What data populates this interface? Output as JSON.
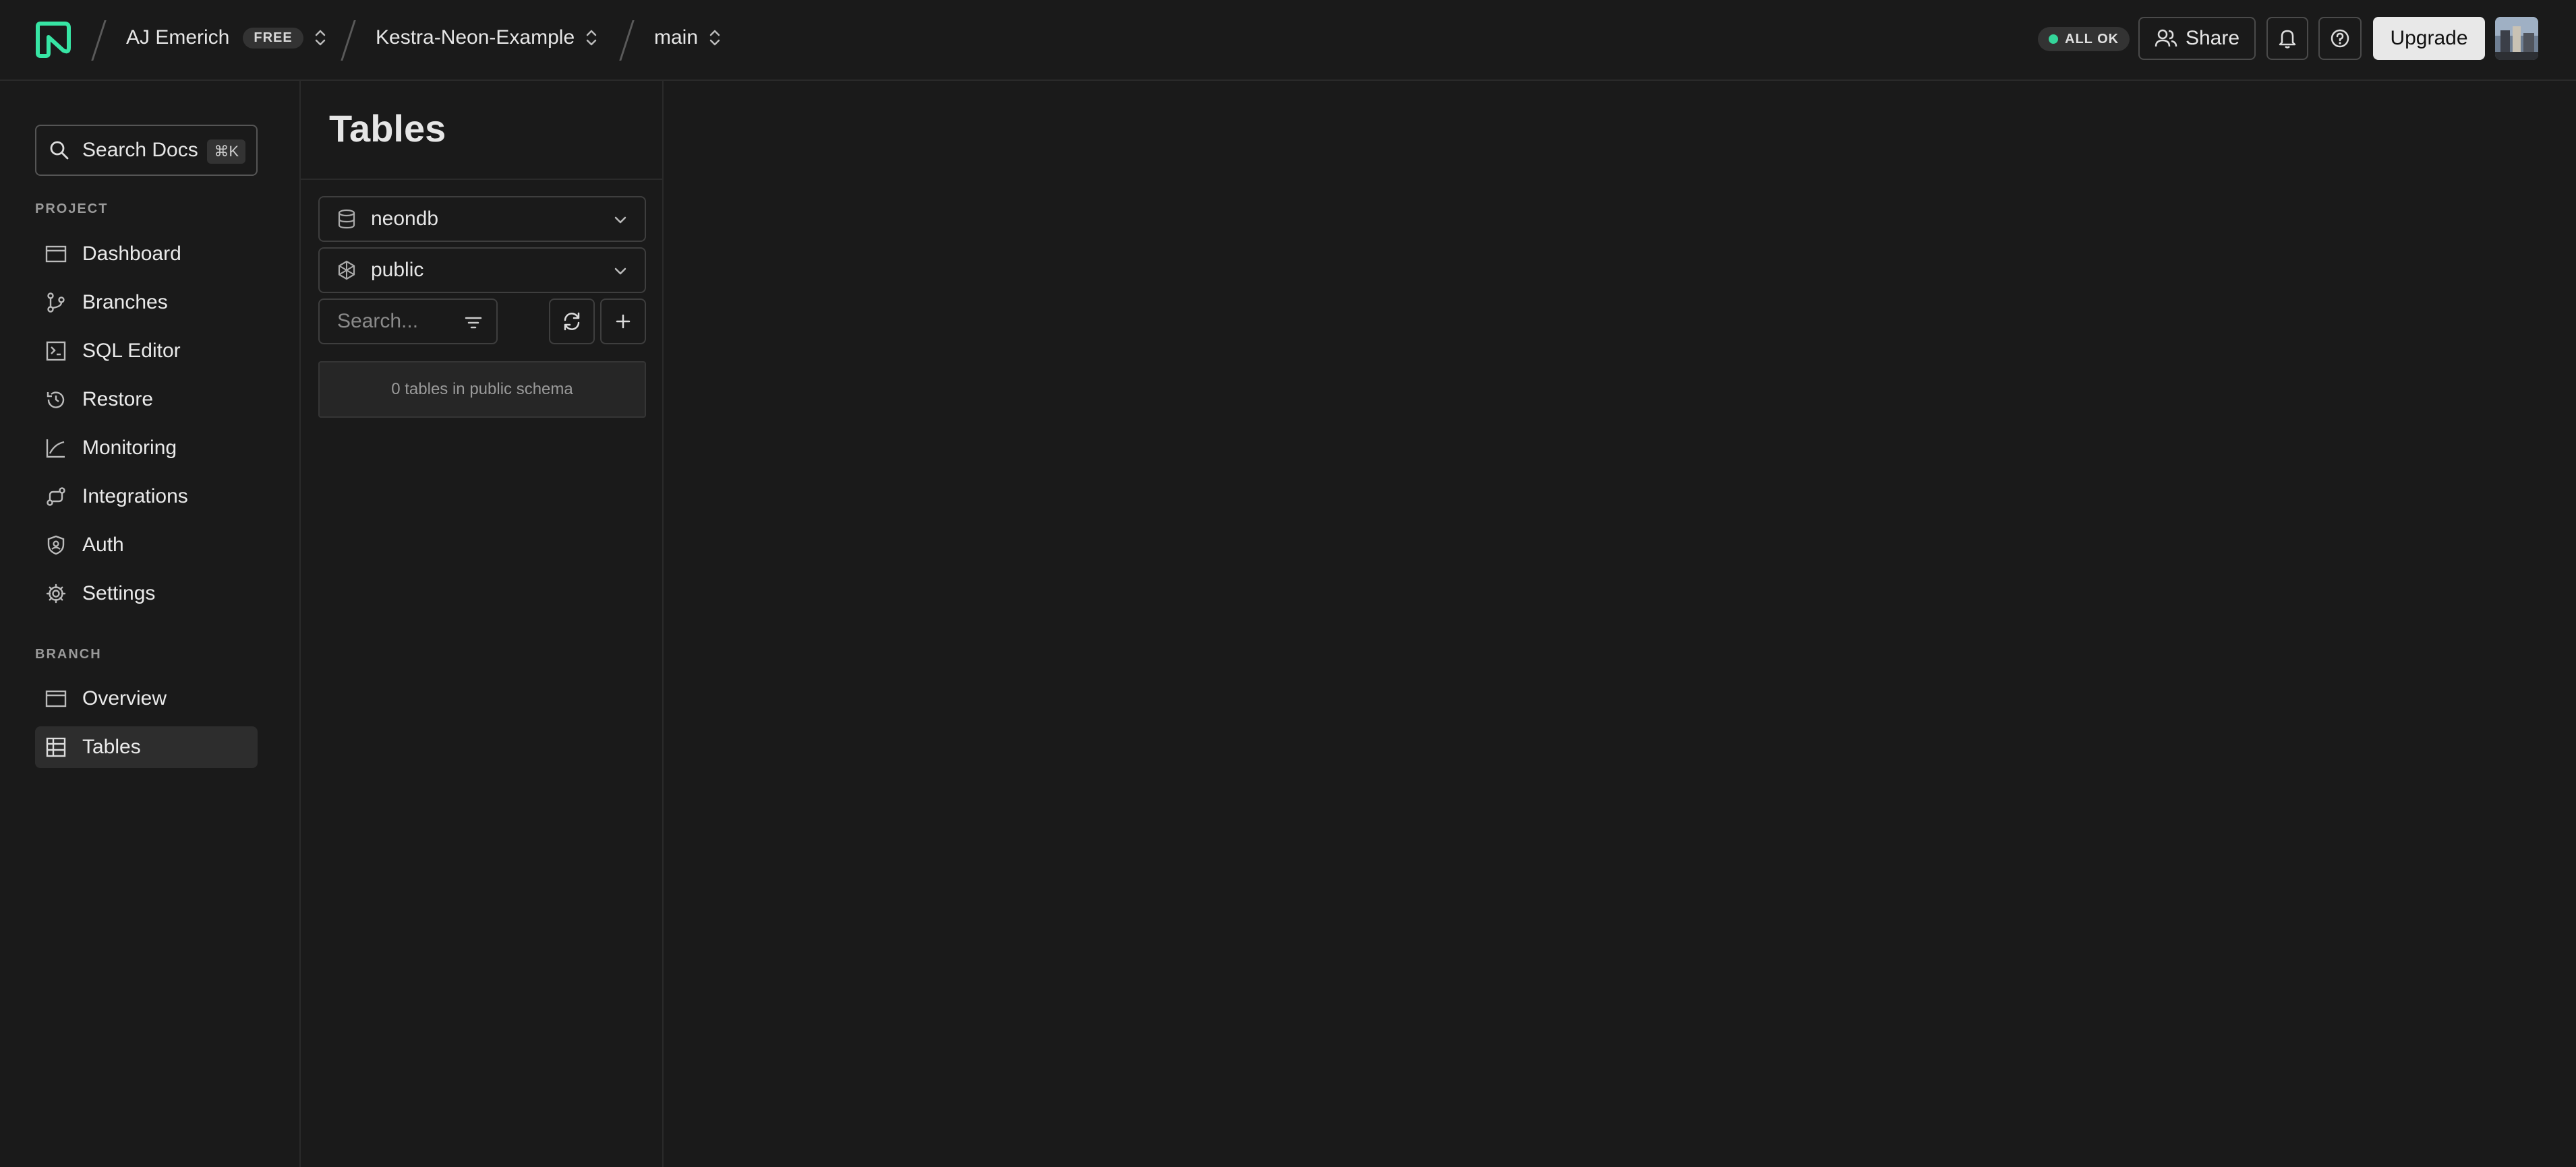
{
  "header": {
    "org_name": "AJ Emerich",
    "plan_badge": "FREE",
    "project_name": "Kestra-Neon-Example",
    "branch_name": "main",
    "status_text": "ALL OK",
    "status_color": "#34d59a",
    "share_label": "Share",
    "upgrade_label": "Upgrade"
  },
  "sidebar": {
    "search_label": "Search Docs",
    "search_shortcut": "⌘K",
    "project_section": "PROJECT",
    "project_items": [
      {
        "label": "Dashboard",
        "icon": "dashboard-icon"
      },
      {
        "label": "Branches",
        "icon": "branches-icon"
      },
      {
        "label": "SQL Editor",
        "icon": "sql-editor-icon"
      },
      {
        "label": "Restore",
        "icon": "restore-icon"
      },
      {
        "label": "Monitoring",
        "icon": "monitoring-icon"
      },
      {
        "label": "Integrations",
        "icon": "integrations-icon"
      },
      {
        "label": "Auth",
        "icon": "auth-icon"
      },
      {
        "label": "Settings",
        "icon": "settings-icon"
      }
    ],
    "branch_section": "BRANCH",
    "branch_items": [
      {
        "label": "Overview",
        "icon": "overview-icon"
      },
      {
        "label": "Tables",
        "icon": "tables-icon",
        "active": true
      }
    ]
  },
  "tables_panel": {
    "title": "Tables",
    "database_value": "neondb",
    "schema_value": "public",
    "search_placeholder": "Search...",
    "empty_message": "0 tables in public schema"
  }
}
